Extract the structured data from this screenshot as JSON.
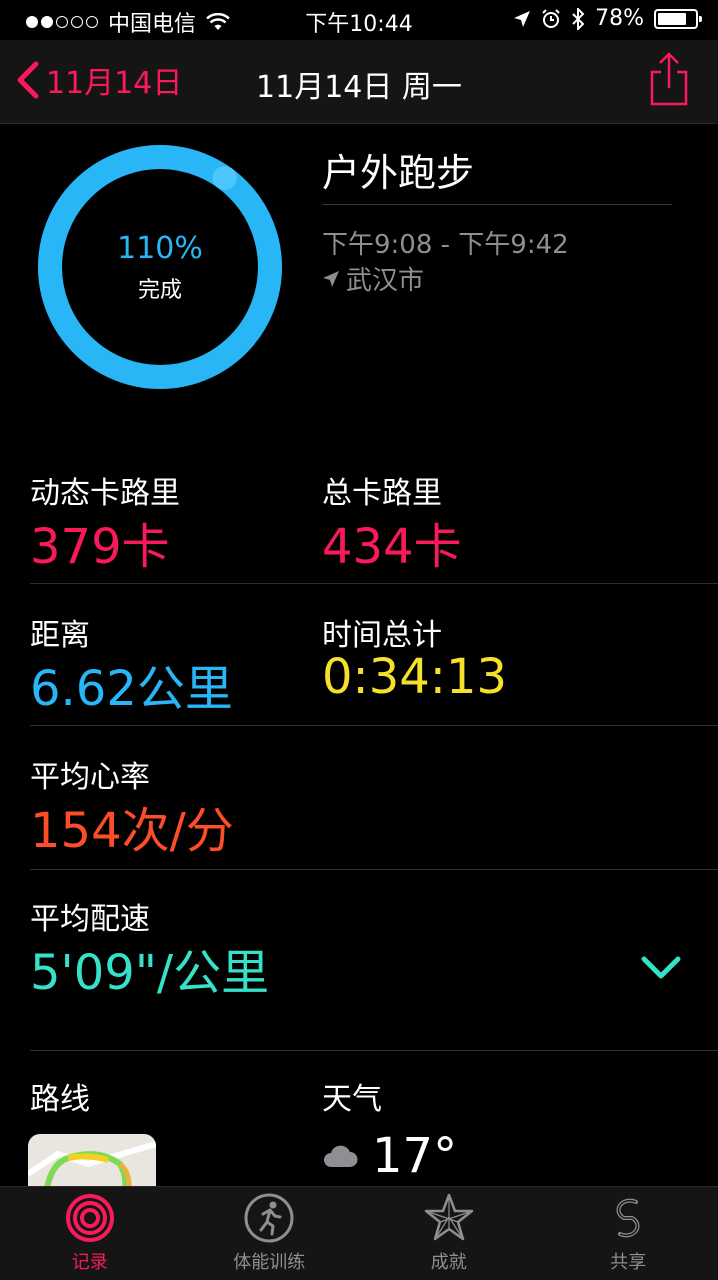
{
  "status_bar": {
    "carrier": "中国电信",
    "time": "下午10:44",
    "battery": "78%",
    "battery_level": 0.78
  },
  "nav": {
    "back_label": "11月14日",
    "title": "11月14日 周一"
  },
  "workout": {
    "ring_percent": "110%",
    "ring_value": 1.1,
    "ring_label": "完成",
    "title": "户外跑步",
    "time_range": "下午9:08 - 下午9:42",
    "location": "武汉市"
  },
  "metrics": {
    "active_cal": {
      "label": "动态卡路里",
      "value": "379卡"
    },
    "total_cal": {
      "label": "总卡路里",
      "value": "434卡"
    },
    "distance": {
      "label": "距离",
      "value": "6.62公里"
    },
    "duration": {
      "label": "时间总计",
      "value": "0:34:13"
    },
    "heart_rate": {
      "label": "平均心率",
      "value": "154次/分"
    },
    "pace": {
      "label": "平均配速",
      "value": "5'09\"/公里"
    }
  },
  "route": {
    "label": "路线"
  },
  "weather": {
    "label": "天气",
    "temperature": "17°"
  },
  "colors": {
    "accent": "#fa1a5a",
    "calories": "#fa1a5a",
    "distance": "#28b6f6",
    "duration": "#f5e12a",
    "heart_rate": "#ff4d2a",
    "pace": "#37e0c8",
    "ring": "#28b6f6"
  },
  "tabs": [
    {
      "label": "记录",
      "icon": "activity-rings-icon",
      "active": true
    },
    {
      "label": "体能训练",
      "icon": "running-figure-icon",
      "active": false
    },
    {
      "label": "成就",
      "icon": "star-icon",
      "active": false
    },
    {
      "label": "共享",
      "icon": "share-s-icon",
      "active": false
    }
  ]
}
